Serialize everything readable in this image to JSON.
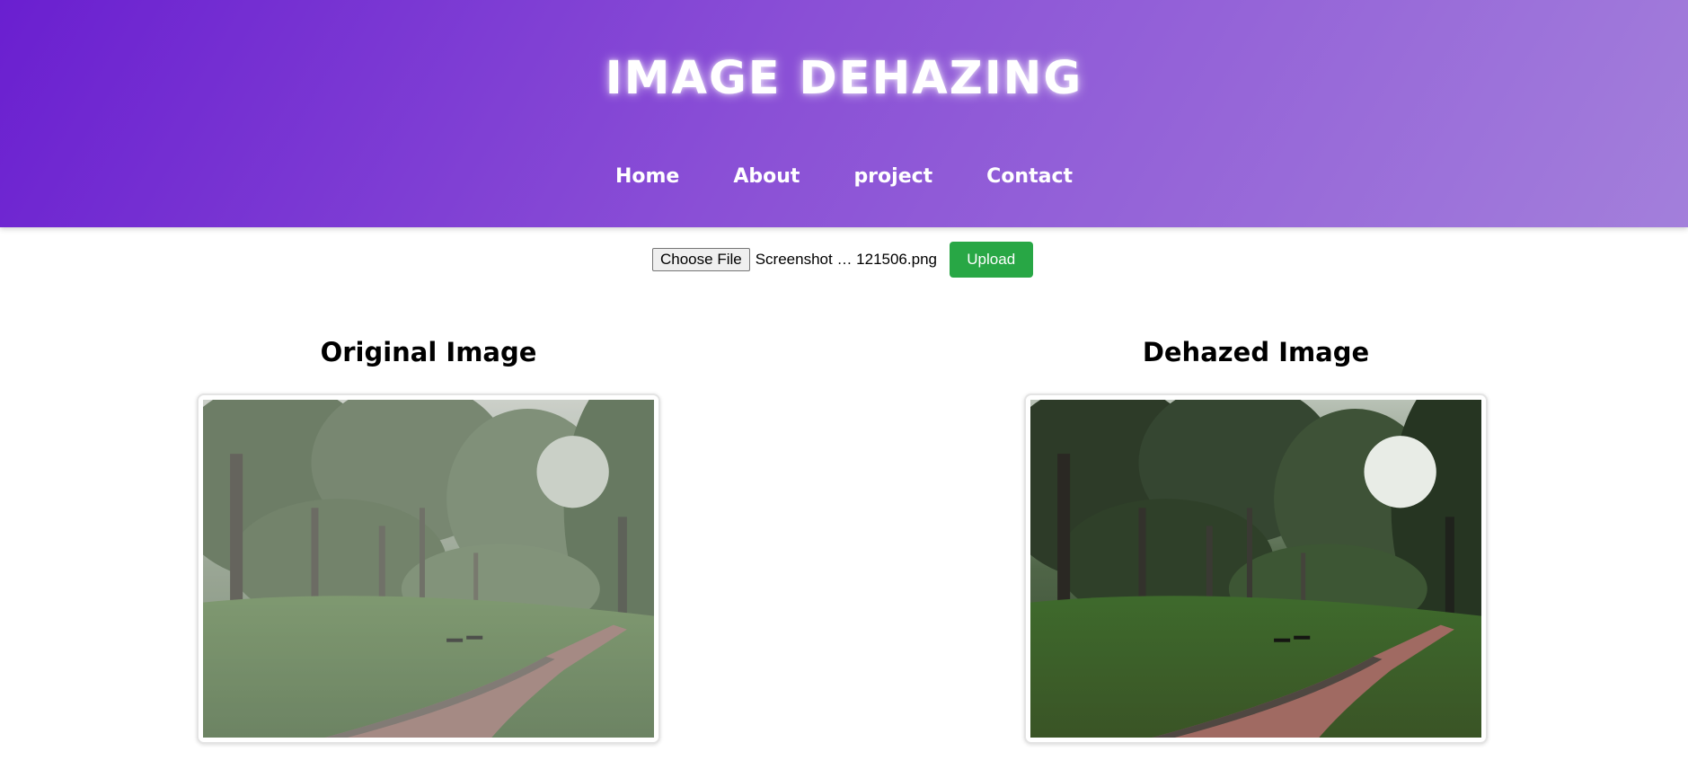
{
  "header": {
    "title": "IMAGE DEHAZING",
    "nav": [
      "Home",
      "About",
      "project",
      "Contact"
    ]
  },
  "upload": {
    "choose_label": "Choose File",
    "file_name": "Screenshot … 121506.png",
    "upload_label": "Upload"
  },
  "panels": {
    "original": {
      "title": "Original Image"
    },
    "dehazed": {
      "title": "Dehazed Image"
    }
  },
  "colors": {
    "header_gradient_start": "#6a1fd0",
    "header_gradient_end": "#a37fdb",
    "upload_button": "#28a745"
  }
}
